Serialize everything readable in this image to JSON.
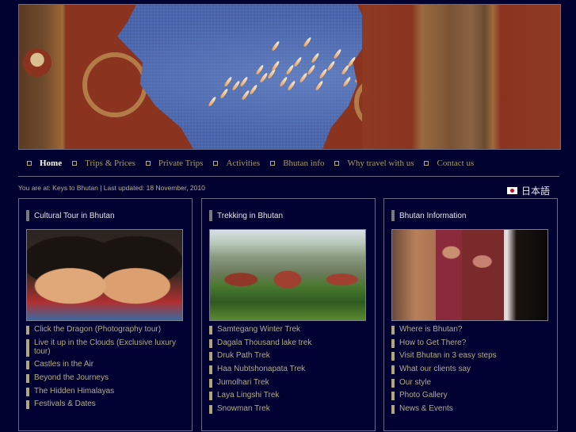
{
  "banner": {
    "alt": "Butter lamps behind carved Bhutanese doors"
  },
  "nav": {
    "items": [
      {
        "label": "Home",
        "active": true
      },
      {
        "label": "Trips & Prices"
      },
      {
        "label": "Private Trips"
      },
      {
        "label": "Activities"
      },
      {
        "label": "Bhutan info"
      },
      {
        "label": "Why travel with us"
      },
      {
        "label": "Contact us"
      }
    ]
  },
  "breadcrumb": {
    "prefix": "You are at: ",
    "link": "Keys to Bhutan",
    "separator": " | ",
    "updated": "Last updated: 18 November, 2010"
  },
  "language": {
    "label": "日本語",
    "flag": "japan-flag-icon"
  },
  "colors": {
    "background": "#020230",
    "nav_text": "#a89a6a",
    "list_text": "#b4ac84",
    "bullet": "#b0a878"
  },
  "boxes": [
    {
      "title": "Cultural Tour in Bhutan",
      "photo": "smiling-children-photo",
      "links": [
        "Click the Dragon (Photography tour)",
        "Live it up in the Clouds (Exclusive luxury tour)",
        "Castles in the Air",
        "Beyond the Journeys",
        "The Hidden Himalayas",
        "Festivals & Dates"
      ]
    },
    {
      "title": "Trekking in Bhutan",
      "photo": "dzong-valley-photo",
      "links": [
        "Samtegang Winter Trek",
        "Dagala Thousand lake trek",
        "Druk Path Trek",
        "Haa Nubtshonapata Trek",
        "Jumolhari Trek",
        "Laya Lingshi Trek",
        "Snowman Trek"
      ]
    },
    {
      "title": "Bhutan Information",
      "photo": "travellers-photo",
      "links": [
        "Where is Bhutan?",
        "How to Get There?",
        "Visit Bhutan in 3 easy steps",
        "What our clients say",
        "Our style",
        "Photo Gallery",
        "News & Events"
      ]
    }
  ]
}
